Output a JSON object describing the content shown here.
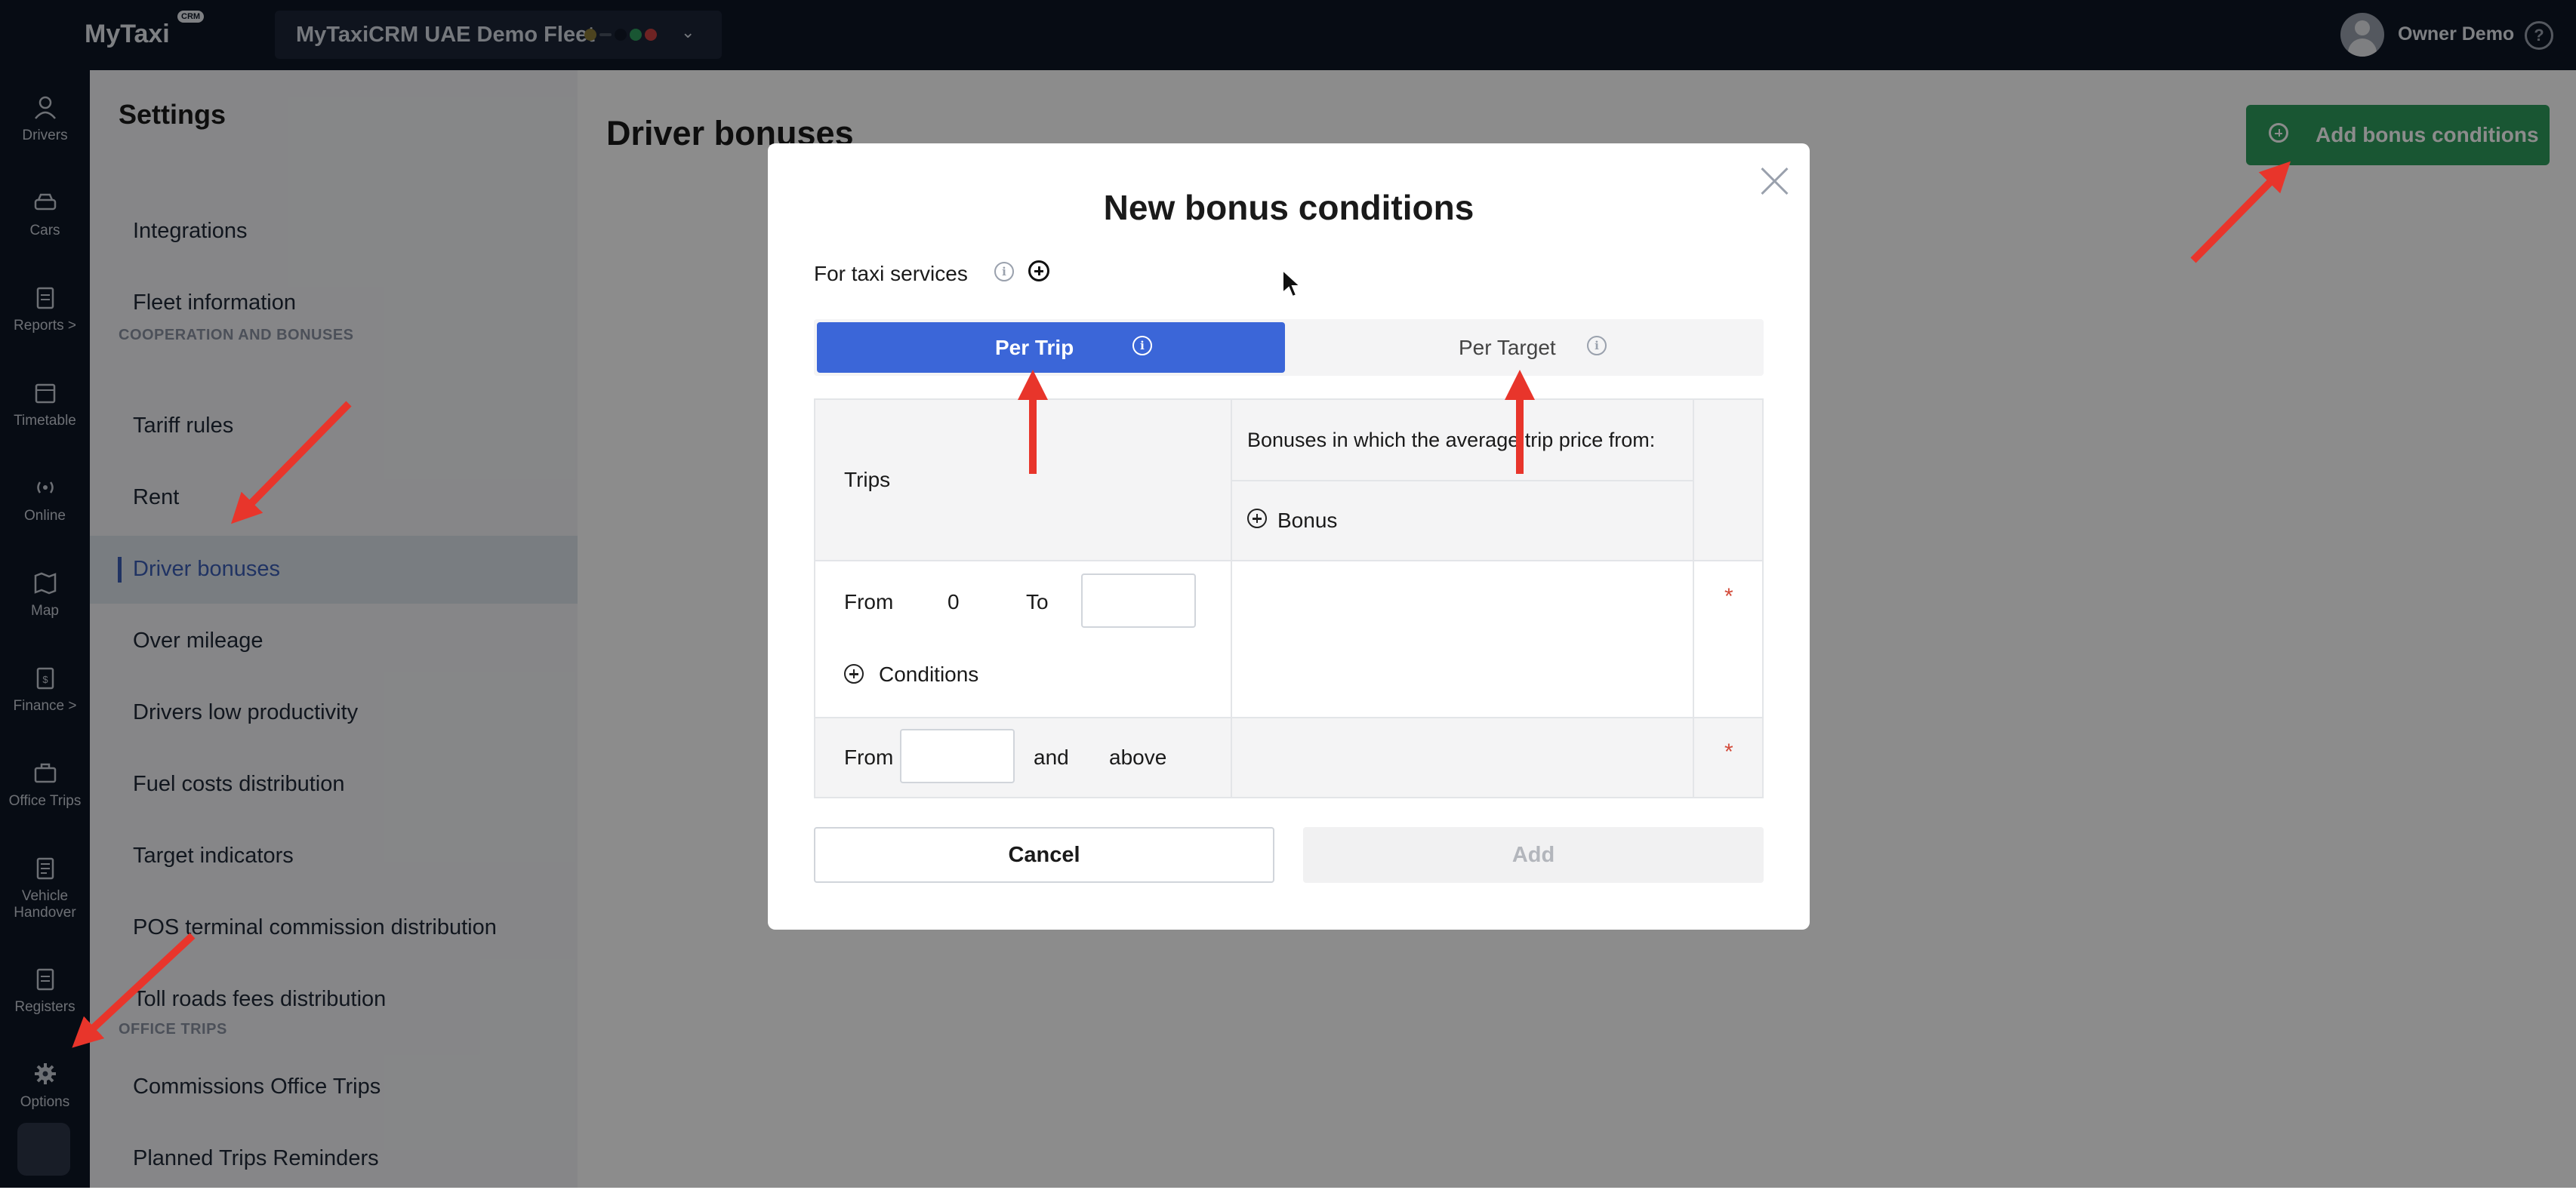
{
  "topbar": {
    "logo": "MyTaxi",
    "logo_badge": "CRM",
    "fleet_name": "MyTaxiCRM UAE Demo Fleet",
    "fleet_status_colors": [
      "#8a7a3a",
      "#1f2937",
      "#1f2937",
      "#2e9d5d",
      "#c94141"
    ],
    "user_name": "Owner Demo",
    "help_icon": "question-circle-icon"
  },
  "leftnav": {
    "items": [
      {
        "label": "Drivers",
        "icon": "user-icon"
      },
      {
        "label": "Cars",
        "icon": "car-icon"
      },
      {
        "label": "Reports >",
        "icon": "clipboard-icon"
      },
      {
        "label": "Timetable",
        "icon": "calendar-icon"
      },
      {
        "label": "Online",
        "icon": "broadcast-icon"
      },
      {
        "label": "Map",
        "icon": "map-icon"
      },
      {
        "label": "Finance >",
        "icon": "finance-icon"
      },
      {
        "label": "Office Trips",
        "icon": "briefcase-icon"
      },
      {
        "label": "Vehicle Handover",
        "icon": "document-icon"
      },
      {
        "label": "Registers",
        "icon": "clipboard-icon"
      },
      {
        "label": "Options",
        "icon": "gear-icon",
        "active": true
      }
    ]
  },
  "settings": {
    "title": "Settings",
    "items_top": [
      "Integrations",
      "Fleet information"
    ],
    "section_coop": "COOPERATION AND BONUSES",
    "items_coop": [
      "Tariff rules",
      "Rent",
      "Driver bonuses",
      "Over mileage",
      "Drivers low productivity",
      "Fuel costs distribution",
      "Target indicators",
      "POS terminal commission distribution",
      "Toll roads fees distribution"
    ],
    "active_item": "Driver bonuses",
    "section_office": "OFFICE TRIPS",
    "items_office": [
      "Commissions Office Trips",
      "Planned Trips Reminders"
    ]
  },
  "main": {
    "page_title": "Driver bonuses",
    "add_button": "Add bonus conditions"
  },
  "modal": {
    "title": "New bonus conditions",
    "service_label": "For taxi services",
    "tabs": {
      "per_trip": "Per Trip",
      "per_target": "Per Target",
      "active": "Per Trip"
    },
    "table": {
      "col_trips": "Trips",
      "col_bonuses": "Bonuses in which the average trip price from:",
      "add_bonus": "Bonus",
      "row1": {
        "from_label": "From",
        "from_value": "0",
        "to_label": "To",
        "to_value": "",
        "conditions": "Conditions",
        "required": "*"
      },
      "row2": {
        "from_label": "From",
        "from_value": "",
        "and_label": "and",
        "above_label": "above",
        "required": "*"
      }
    },
    "cancel": "Cancel",
    "add": "Add"
  },
  "colors": {
    "nav_bg": "#0e1625",
    "accent_blue": "#3b66d8",
    "accent_green": "#2e9d5d",
    "annotation_red": "#e8352b",
    "required_red": "#d34b3a"
  }
}
